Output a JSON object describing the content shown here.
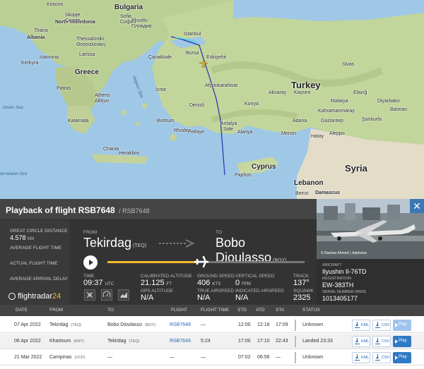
{
  "map": {
    "countries": [
      {
        "id": "bulgaria",
        "label": "Bulgaria"
      },
      {
        "id": "greece",
        "label": "Greece"
      },
      {
        "id": "turkey",
        "label": "Turkey"
      },
      {
        "id": "albania",
        "label": "Albania"
      },
      {
        "id": "north-macedonia",
        "label": "North Macedonia"
      },
      {
        "id": "cyprus",
        "label": "Cyprus"
      },
      {
        "id": "syria",
        "label": "Syria"
      },
      {
        "id": "lebanon",
        "label": "Lebanon"
      },
      {
        "id": "kosovo",
        "label": "Kosovo"
      }
    ],
    "cities": [
      {
        "id": "sofia",
        "label": "Sofia"
      },
      {
        "id": "sofia-local",
        "label": "София"
      },
      {
        "id": "plovdiv",
        "label": "Plovdiv"
      },
      {
        "id": "plovdiv-local",
        "label": "Пловдив"
      },
      {
        "id": "skopje",
        "label": "Skopje"
      },
      {
        "id": "skopje-local",
        "label": "Скопје"
      },
      {
        "id": "tirana",
        "label": "Tirana"
      },
      {
        "id": "thessaloniki",
        "label": "Thessaloniki"
      },
      {
        "id": "thessaloniki-local",
        "label": "Θεσσαλονίκη"
      },
      {
        "id": "istanbul",
        "label": "İstanbul"
      },
      {
        "id": "bursa",
        "label": "Bursa"
      },
      {
        "id": "eskisehir",
        "label": "Eskişehir"
      },
      {
        "id": "izmir",
        "label": "İzmir"
      },
      {
        "id": "athens",
        "label": "Athens"
      },
      {
        "id": "athens-local",
        "label": "Αθήνα"
      },
      {
        "id": "konya",
        "label": "Konya"
      },
      {
        "id": "kayseri",
        "label": "Kayseri"
      },
      {
        "id": "aksaray",
        "label": "Aksaray"
      },
      {
        "id": "antalya",
        "label": "Antalya"
      },
      {
        "id": "adana",
        "label": "Adana"
      },
      {
        "id": "mersin",
        "label": "Mersin"
      },
      {
        "id": "gaziantep",
        "label": "Gaziantep"
      },
      {
        "id": "malatya",
        "label": "Malatya"
      },
      {
        "id": "batman",
        "label": "Batman"
      },
      {
        "id": "diyarbakir",
        "label": "Diyarbakır"
      },
      {
        "id": "sivas",
        "label": "Sivas"
      },
      {
        "id": "elazig",
        "label": "Elazığ"
      },
      {
        "id": "kahramanmaras",
        "label": "Kahramanmaraş"
      },
      {
        "id": "beirut",
        "label": "Beirut"
      },
      {
        "id": "damascus",
        "label": "Damascus"
      },
      {
        "id": "paphos",
        "label": "Paphos"
      },
      {
        "id": "chania",
        "label": "Chania"
      },
      {
        "id": "heraklion",
        "label": "Heraklion"
      },
      {
        "id": "rhodes",
        "label": "Rhodes"
      },
      {
        "id": "patras",
        "label": "Patras"
      },
      {
        "id": "larissa",
        "label": "Larissa"
      },
      {
        "id": "kerkyra",
        "label": "Kerkyra"
      },
      {
        "id": "ioannina",
        "label": "Ioannina"
      },
      {
        "id": "kalamata",
        "label": "Kalamata"
      },
      {
        "id": "denizli",
        "label": "Denizli"
      },
      {
        "id": "fethiye",
        "label": "Fethiye"
      },
      {
        "id": "bodrum",
        "label": "Bodrum"
      },
      {
        "id": "afyonkarahisar",
        "label": "Afyonkarahisar"
      },
      {
        "id": "side",
        "label": "Side"
      },
      {
        "id": "alanya",
        "label": "Alanya"
      },
      {
        "id": "canakkale",
        "label": "Çanakkale"
      },
      {
        "id": "sanliurfa",
        "label": "Şanlıurfa"
      },
      {
        "id": "hatay",
        "label": "Hatay"
      },
      {
        "id": "aleppo",
        "label": "Aleppo"
      }
    ],
    "seas": [
      {
        "id": "ionian-sea",
        "label": "Ionian Sea"
      },
      {
        "id": "aegean-sea",
        "label": "Aegean Sea"
      },
      {
        "id": "mediterranean-sea",
        "label": "terranean Sea"
      }
    ],
    "colors": {
      "sea": "#9fc7e6",
      "land": "#c8d9a6",
      "track_blue": "#2233aa",
      "track_cyan": "#4fd2e6"
    }
  },
  "panel": {
    "title": "Playback of flight RSB7648",
    "subtitle": "/ RSB7648",
    "stats": [
      {
        "label": "GREAT CIRCLE DISTANCE",
        "value": "4.578",
        "unit": "KM"
      },
      {
        "label": "AVERAGE FLIGHT TIME",
        "value": "",
        "unit": ""
      },
      {
        "label": "ACTUAL FLIGHT TIME",
        "value": "",
        "unit": ""
      },
      {
        "label": "AVERAGE ARRIVAL DELAY",
        "value": "",
        "unit": ""
      }
    ],
    "logo": {
      "brand": "flightradar",
      "number": "24"
    },
    "from": {
      "cap": "FROM",
      "city": "Tekirdag",
      "code": "(TEQ)"
    },
    "to": {
      "cap": "TO",
      "city": "Bobo Dioulasso",
      "code": "(BOY)"
    },
    "progress_fraction": 0.45,
    "time": {
      "cap": "TIME",
      "value": "09:37",
      "unit": "UTC"
    },
    "calibrated_altitude": {
      "cap": "CALIBRATED ALTITUDE",
      "value": "21.125",
      "unit": "FT"
    },
    "gps_altitude": {
      "cap": "GPS ALTITUDE",
      "value": "N/A"
    },
    "ground_speed": {
      "cap": "GROUND SPEED",
      "value": "406",
      "unit": "KTS"
    },
    "true_airspeed": {
      "cap": "TRUE AIRSPEED",
      "value": "N/A"
    },
    "vertical_speed": {
      "cap": "VERTICAL SPEED",
      "value": "0",
      "unit": "FPM"
    },
    "indicated_airspeed": {
      "cap": "INDICATED AIRSPEED",
      "value": "N/A"
    },
    "track": {
      "cap": "TRACK",
      "value": "137°"
    },
    "squawk": {
      "cap": "SQUAWK",
      "value": "2325"
    }
  },
  "aircraft": {
    "photo_credit": "© Rashan Ahmed | Jetphotos",
    "close": "✕",
    "aircraft_cap": "AIRCRAFT",
    "aircraft_value": "Ilyushin Il-76TD",
    "registration_cap": "REGISTRATION",
    "registration_value": "EW-383TH",
    "serial_cap": "SERIAL NUMBER (MSN)",
    "serial_value": "1013405177"
  },
  "table": {
    "headers": [
      "DATE",
      "FROM",
      "TO",
      "FLIGHT",
      "FLIGHT TIME",
      "STD",
      "ATD",
      "STA",
      "STATUS"
    ],
    "kml_label": "KML",
    "csv_label": "CSV",
    "play_label": "Play",
    "rows": [
      {
        "date": "07 Apr 2022",
        "from": "Tekirdag",
        "from_code": "(TEQ)",
        "to": "Bobo Dioulasso",
        "to_code": "(BOY)",
        "flight": "RSB7648",
        "flight_time": "—",
        "std": "12:00",
        "atd": "12:16",
        "sta": "17:09",
        "status": "Unknown"
      },
      {
        "date": "06 Apr 2022",
        "from": "Khartoum",
        "from_code": "(KRT)",
        "to": "Tekirdag",
        "to_code": "(TEQ)",
        "flight": "RSB7646",
        "flight_time": "5:24",
        "std": "17:00",
        "atd": "17:10",
        "sta": "22:43",
        "status": "Landed 23:33"
      },
      {
        "date": "21 Mar 2022",
        "from": "Campinas",
        "from_code": "(VCP)",
        "to": "—",
        "to_code": "",
        "flight": "—",
        "flight_time": "—",
        "std": "07:02",
        "atd": "06:56",
        "sta": "—",
        "status": "Unknown"
      }
    ]
  }
}
